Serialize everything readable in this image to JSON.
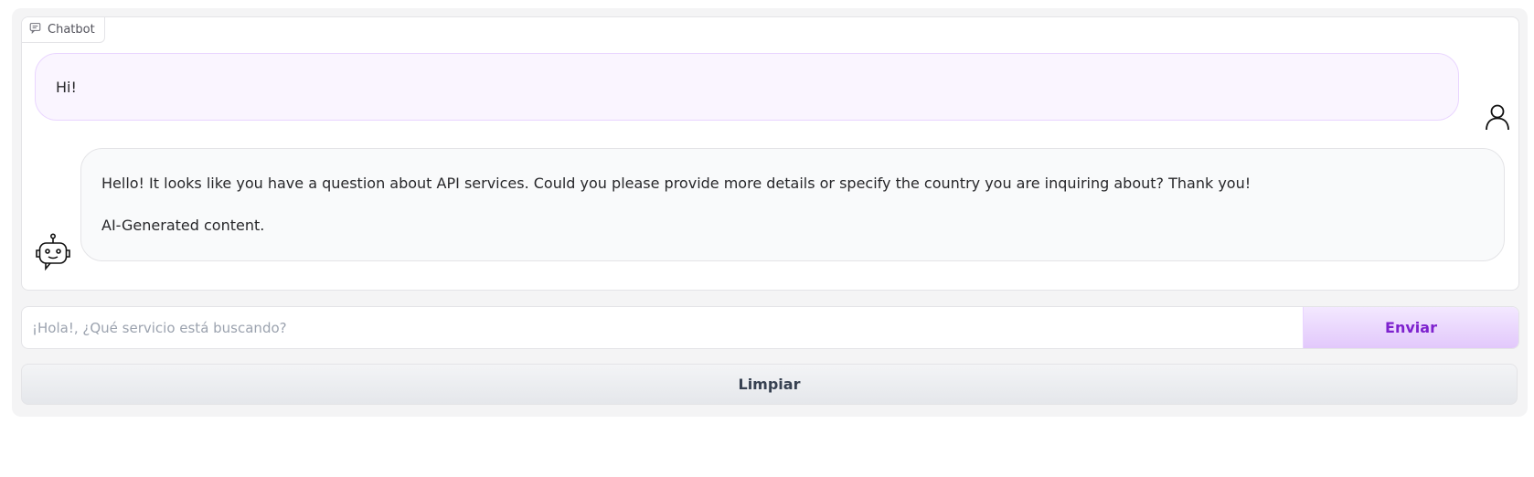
{
  "chatbot": {
    "label": "Chatbot",
    "label_icon": "chat-bubble-icon",
    "messages": [
      {
        "role": "user",
        "avatar_icon": "user-icon",
        "text": "Hi!"
      },
      {
        "role": "bot",
        "avatar_icon": "robot-icon",
        "paragraphs": [
          "Hello! It looks like you have a question about API services. Could you please provide more details or specify the country you are inquiring about? Thank you!",
          "AI-Generated content."
        ]
      }
    ]
  },
  "input": {
    "placeholder": "¡Hola!, ¿Qué servicio está buscando?",
    "value": ""
  },
  "buttons": {
    "send_label": "Enviar",
    "clear_label": "Limpiar"
  },
  "colors": {
    "accent": "#7e22ce",
    "user_bubble": "#faf5ff",
    "bot_bubble": "#f9fafb"
  }
}
